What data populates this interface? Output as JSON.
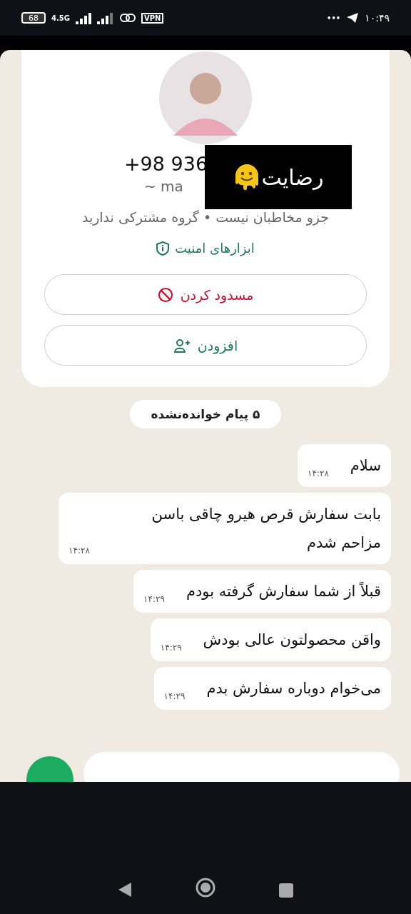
{
  "status_bar": {
    "battery": "68",
    "network": "4.5G",
    "vpn": "VPN",
    "time": "۱۰:۴۹",
    "more": "•••"
  },
  "contact_card": {
    "phone": "+98 936",
    "name": "~ ma",
    "subtitle": "جزو مخاطبان نیست • گروه مشترکی ندارید",
    "security_link": "ابزارهای امنیت",
    "buttons": [
      {
        "kind": "block",
        "label": "مسدود کردن"
      },
      {
        "kind": "add",
        "label": "افزودن"
      }
    ]
  },
  "overlay": {
    "label": "رضایت"
  },
  "unread_banner": "۵ پیام خوانده‌نشده",
  "messages": [
    {
      "text": "سلام",
      "time": "۱۴:۲۸"
    },
    {
      "text": "بابت سفارش قرص هیرو چاقی باسن مزاحم شدم",
      "time": "۱۴:۲۸"
    },
    {
      "text": "قبلاً از شما سفارش گرفته بودم",
      "time": "۱۴:۲۹"
    },
    {
      "text": "واقن محصولتون عالی بودش",
      "time": "۱۴:۲۹"
    },
    {
      "text": "می‌خوام دوباره سفارش بدم",
      "time": "۱۴:۲۹"
    }
  ]
}
